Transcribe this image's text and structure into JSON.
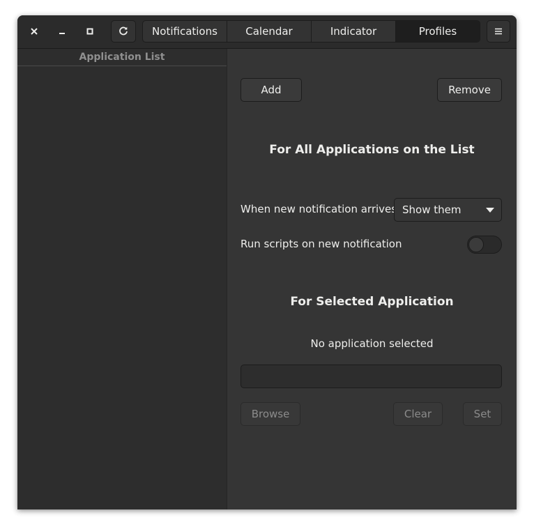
{
  "window": {
    "controls": [
      {
        "icon": "close-icon"
      },
      {
        "icon": "minimize-icon"
      },
      {
        "icon": "maximize-icon"
      }
    ],
    "refresh_icon": "refresh-icon",
    "menu_icon": "hamburger-menu-icon",
    "tabs": [
      {
        "label": "Notifications",
        "active": false
      },
      {
        "label": "Calendar",
        "active": false
      },
      {
        "label": "Indicator",
        "active": false
      },
      {
        "label": "Profiles",
        "active": true
      }
    ]
  },
  "sidebar": {
    "header": "Application List",
    "items": []
  },
  "main": {
    "add_label": "Add",
    "remove_label": "Remove",
    "all_apps_title": "For All Applications on the List",
    "notification_label": "When new notification arrives",
    "notification_value": "Show them",
    "scripts_label": "Run scripts on new notification",
    "scripts_enabled": false,
    "selected_title": "For Selected Application",
    "selected_status": "No application selected",
    "path_value": "",
    "browse_label": "Browse",
    "clear_label": "Clear",
    "set_label": "Set"
  },
  "colors": {
    "window_bg": "#353535",
    "headerbar_bg": "#2b2b2b",
    "sidebar_bg": "#2d2d2d",
    "text": "#eeeeec",
    "disabled_text": "#8b8b8b"
  }
}
